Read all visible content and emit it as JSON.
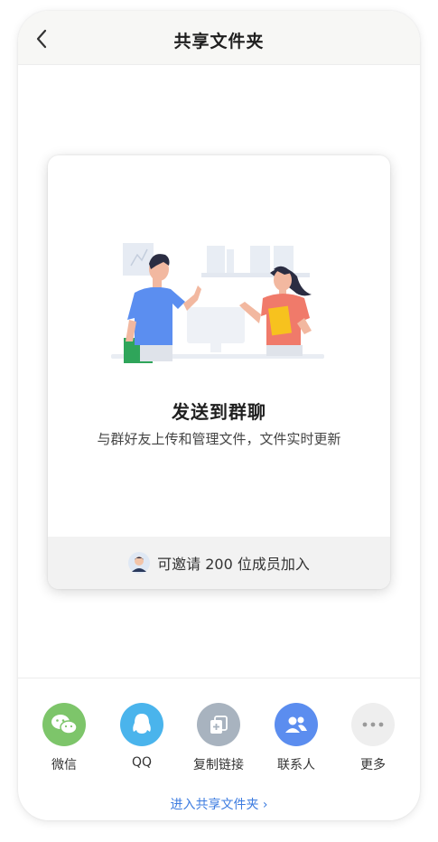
{
  "header": {
    "title": "共享文件夹",
    "back_icon": "chevron-left-icon"
  },
  "card": {
    "title": "发送到群聊",
    "subtitle": "与群好友上传和管理文件，文件实时更新",
    "invite_text": "可邀请 200 位成员加入"
  },
  "share": {
    "items": [
      {
        "label": "微信",
        "icon": "wechat-icon",
        "color": "#7dc56a"
      },
      {
        "label": "QQ",
        "icon": "qq-icon",
        "color": "#4ab4ec"
      },
      {
        "label": "复制链接",
        "icon": "copy-link-icon",
        "color": "#a8b3bf"
      },
      {
        "label": "联系人",
        "icon": "contacts-icon",
        "color": "#5b8def"
      },
      {
        "label": "更多",
        "icon": "more-icon",
        "color": "#eeeeee"
      }
    ]
  },
  "footer": {
    "enter_link": "进入共享文件夹 ›"
  }
}
